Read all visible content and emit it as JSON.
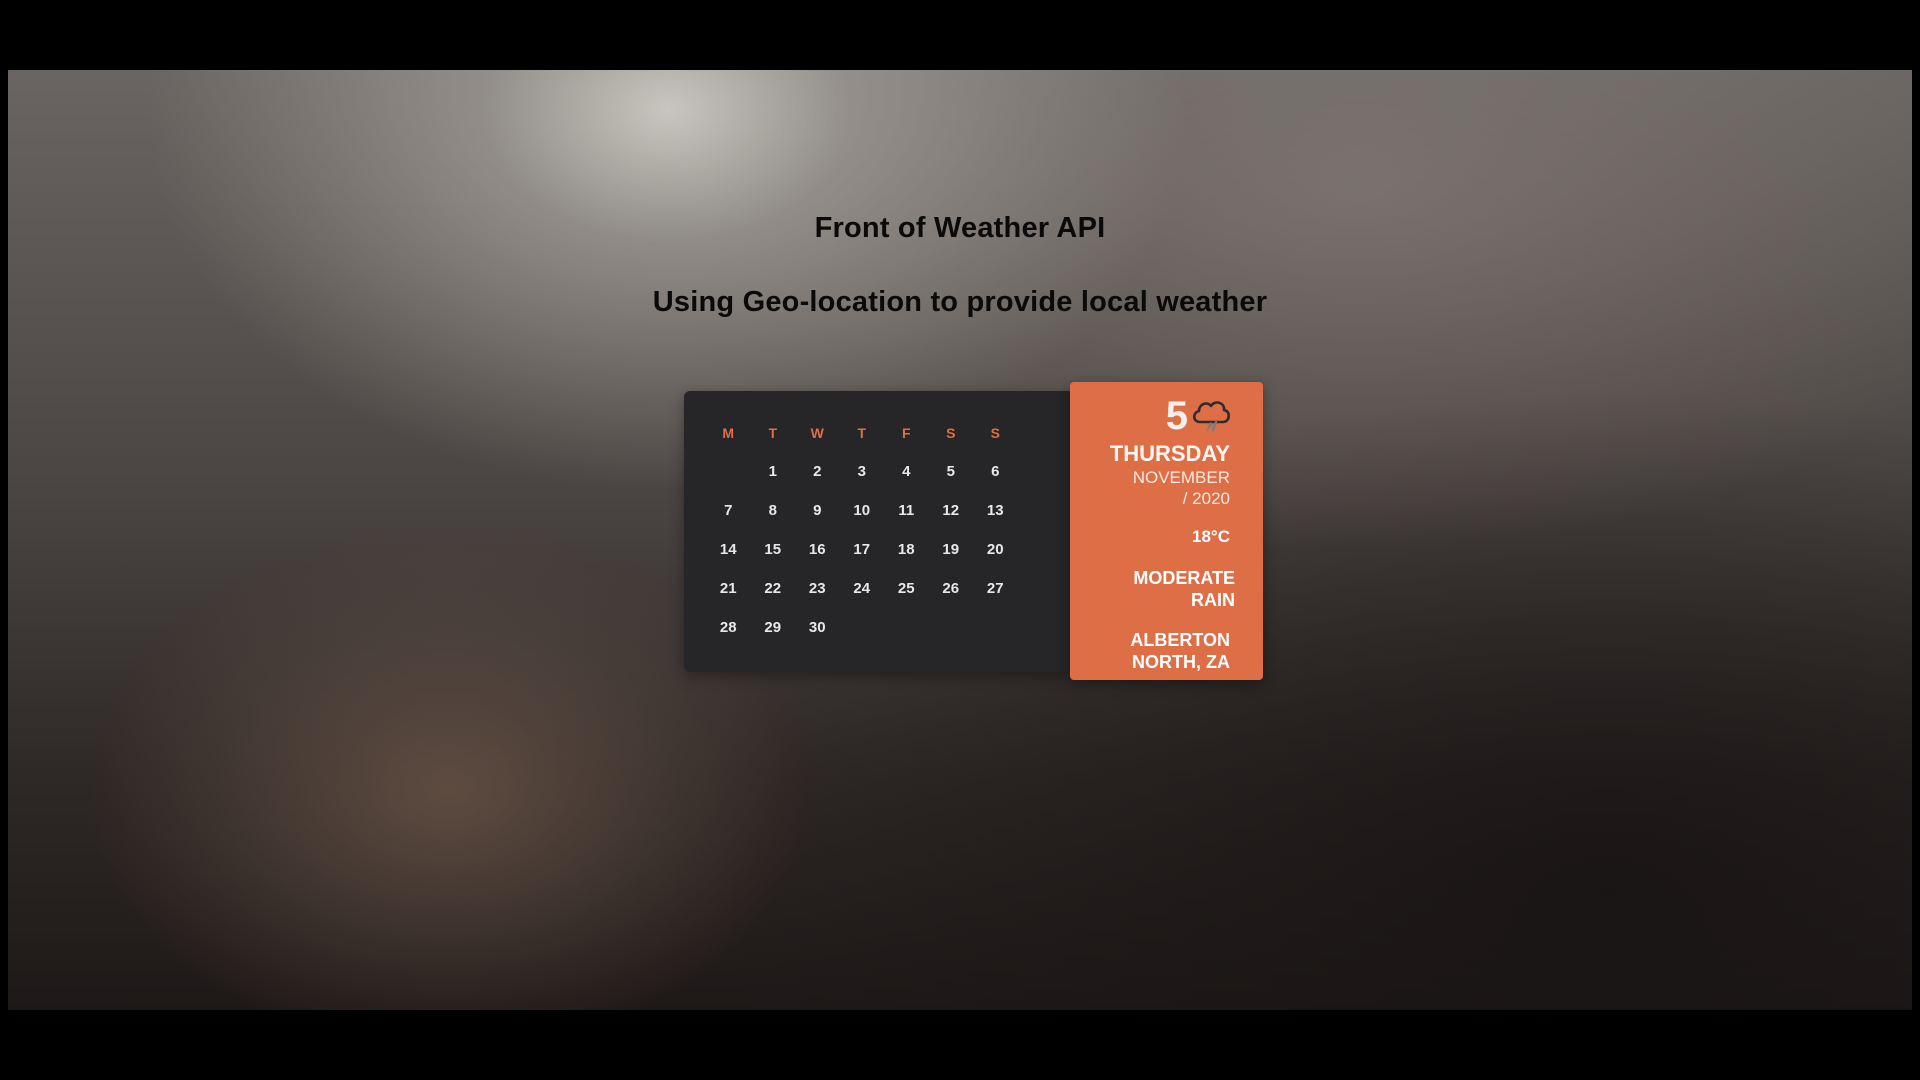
{
  "header": {
    "title": "Front of Weather API",
    "subtitle": "Using Geo-location to provide local weather"
  },
  "calendar": {
    "weekdays": [
      "M",
      "T",
      "W",
      "T",
      "F",
      "S",
      "S"
    ],
    "weeks": [
      [
        "",
        "1",
        "2",
        "3",
        "4",
        "5",
        "6"
      ],
      [
        "7",
        "8",
        "9",
        "10",
        "11",
        "12",
        "13"
      ],
      [
        "14",
        "15",
        "16",
        "17",
        "18",
        "19",
        "20"
      ],
      [
        "21",
        "22",
        "23",
        "24",
        "25",
        "26",
        "27"
      ],
      [
        "28",
        "29",
        "30",
        "",
        "",
        "",
        ""
      ]
    ]
  },
  "weather": {
    "day_number": "5",
    "weekday": "THURSDAY",
    "month": "NOVEMBER",
    "year": "/ 2020",
    "temperature": "18°C",
    "condition_line1": "MODERATE",
    "condition_line2": "RAIN",
    "location_line1": "ALBERTON",
    "location_line2": "NORTH, ZA",
    "icon": "rain-cloud-icon"
  },
  "colors": {
    "accent": "#de6e46",
    "calendar_bg": "#262629",
    "page_bg": "#000000"
  }
}
